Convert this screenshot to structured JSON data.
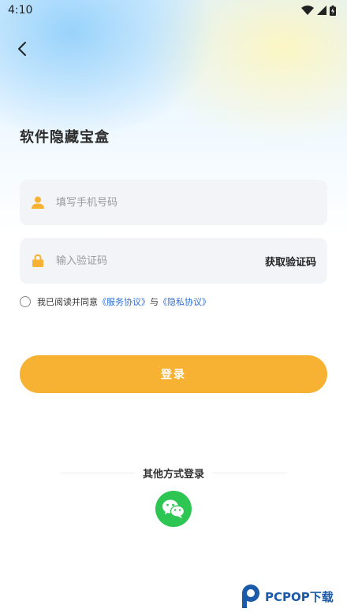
{
  "status_bar": {
    "time": "4:10"
  },
  "page": {
    "title": "软件隐藏宝盒"
  },
  "form": {
    "phone_placeholder": "填写手机号码",
    "code_placeholder": "输入验证码",
    "get_code_label": "获取验证码"
  },
  "agreement": {
    "prefix": "我已阅读并同意",
    "service_link": "《服务协议》",
    "conjunction": "与",
    "privacy_link": "《隐私协议》"
  },
  "login_button": {
    "label": "登录"
  },
  "other_login": {
    "title": "其他方式登录",
    "wechat_icon": "wechat-icon"
  },
  "watermark": {
    "text": "PCPOP下载"
  },
  "colors": {
    "primary": "#f7b233",
    "link": "#2f6fd6",
    "wechat": "#2dc653",
    "field_bg": "#f3f4f8"
  }
}
